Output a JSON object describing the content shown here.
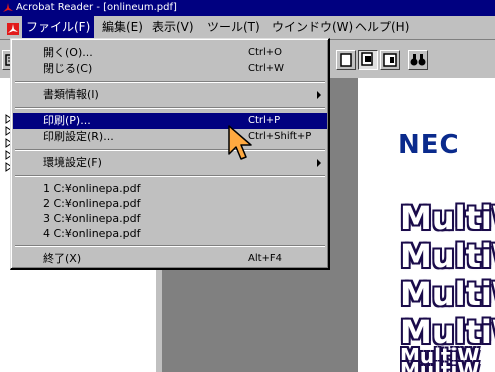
{
  "window": {
    "title": "Acrobat Reader - [onlineum.pdf]"
  },
  "menubar": {
    "items": [
      {
        "label": "ファイル(F)",
        "active": true
      },
      {
        "label": "編集(E)"
      },
      {
        "label": "表示(V)"
      },
      {
        "label": "ツール(T)"
      },
      {
        "label": "ウインドウ(W)"
      },
      {
        "label": "ヘルプ(H)"
      }
    ]
  },
  "file_menu": {
    "open": {
      "label": "開く(O)...",
      "shortcut": "Ctrl+O"
    },
    "close": {
      "label": "閉じる(C)",
      "shortcut": "Ctrl+W"
    },
    "doc_info": {
      "label": "書類情報(I)"
    },
    "print": {
      "label": "印刷(P)...",
      "shortcut": "Ctrl+P"
    },
    "print_setup": {
      "label": "印刷設定(R)...",
      "shortcut": "Ctrl+Shift+P"
    },
    "preferences": {
      "label": "環境設定(F)"
    },
    "recent": [
      {
        "label": "1 C:¥onlinepa.pdf"
      },
      {
        "label": "2 C:¥onlinepa.pdf"
      },
      {
        "label": "3 C:¥onlinepa.pdf"
      },
      {
        "label": "4 C:¥onlinepa.pdf"
      }
    ],
    "exit": {
      "label": "終了(X)",
      "shortcut": "Alt+F4"
    }
  },
  "document": {
    "logo_text": "NEC",
    "multi_text": "MultiW"
  },
  "colors": {
    "titlebar": "#000080",
    "selection": "#000080",
    "logo": "#0a2a8c",
    "multi_outline": "#1a0b4a"
  },
  "icons": [
    "acrobat-app-icon",
    "acrobat-doc-icon",
    "bookmark-marker-icon",
    "hand-pointer-cursor-icon",
    "binoculars-find-icon"
  ]
}
